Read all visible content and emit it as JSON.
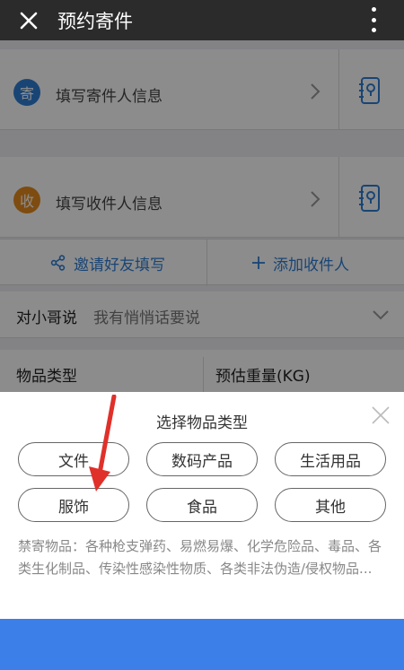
{
  "header": {
    "title": "预约寄件",
    "close_icon": "close-icon",
    "more_icon": "more-vertical-icon"
  },
  "sender": {
    "badge": "寄",
    "label": "填写寄件人信息",
    "badge_color": "#2f7fd6"
  },
  "recipient": {
    "badge": "收",
    "label": "填写收件人信息",
    "badge_color": "#e68a1e"
  },
  "actions": {
    "invite_label": "邀请好友填写",
    "add_label": "添加收件人"
  },
  "courier_message": {
    "label": "对小哥说",
    "placeholder": "我有悄悄话要说"
  },
  "fields": {
    "item_type_label": "物品类型",
    "weight_label": "预估重量(KG)"
  },
  "sheet": {
    "title": "选择物品类型",
    "options": [
      "文件",
      "数码产品",
      "生活用品",
      "服饰",
      "食品",
      "其他"
    ],
    "prohibited_notice": "禁寄物品：各种枪支弹药、易燃易爆、化学危险品、毒品、各类生化制品、传染性感染性物质、各类非法伪造/侵权物品..."
  },
  "colors": {
    "accent": "#2f7fd6",
    "header_bg": "#2b2b2b",
    "annotation_arrow": "#e0302a",
    "bottom_bar": "#3d7fe8"
  }
}
